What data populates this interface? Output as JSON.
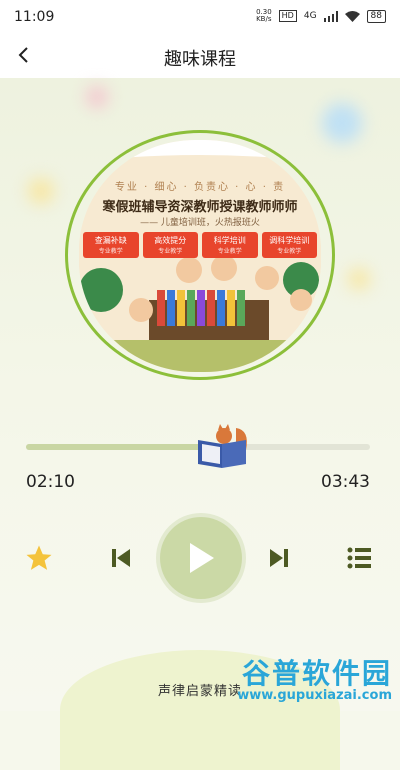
{
  "status_bar": {
    "time": "11:09",
    "net_speed": "0.30\nKB/s",
    "hd": "HD",
    "signal": "4G",
    "battery": "88"
  },
  "header": {
    "title": "趣味课程",
    "back_icon": "chevron-left-icon"
  },
  "cover": {
    "tagline": "专业 · 细心 · 负责心 · 心 · 责",
    "headline": "寒假班辅导资深教师授课教师师师",
    "subline": "—— 儿童培训班，火热报班火",
    "tags": [
      {
        "title": "查漏补缺",
        "sub": "专业教学"
      },
      {
        "title": "高效提分",
        "sub": "专业教学"
      },
      {
        "title": "科学培训",
        "sub": "专业教学"
      },
      {
        "title": "调科学培训",
        "sub": "专业教学"
      }
    ]
  },
  "player": {
    "elapsed": "02:10",
    "total": "03:43",
    "progress": 0.58,
    "favorite_icon": "star-icon",
    "prev_icon": "skip-previous-icon",
    "play_icon": "play-icon",
    "next_icon": "skip-next-icon",
    "playlist_icon": "playlist-icon"
  },
  "footer": {
    "text": "声律启蒙精读"
  },
  "watermark": {
    "title": "谷普软件园",
    "url": "www.gupuxiazai.com"
  },
  "colors": {
    "accent_green": "#4d5a23",
    "play_bg": "#cbd9a6",
    "star": "#f4c33b",
    "watermark": "#2aa6d8"
  }
}
